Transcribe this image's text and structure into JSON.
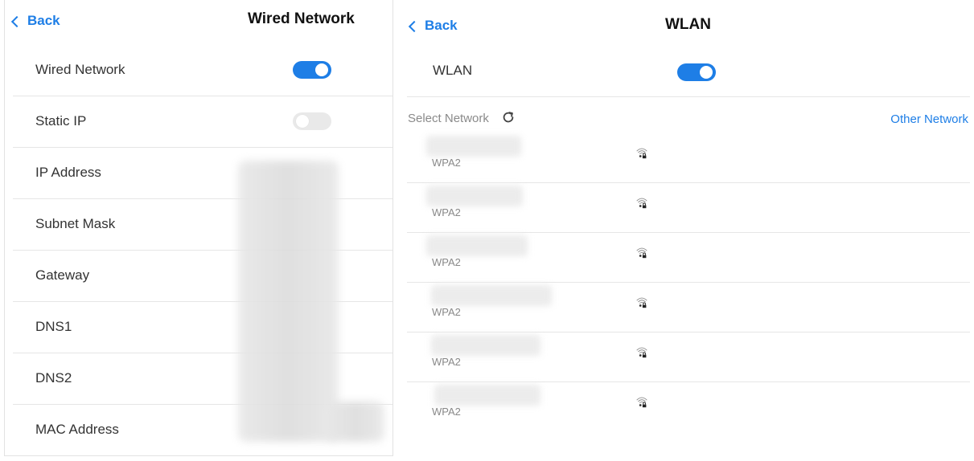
{
  "left": {
    "back_label": "Back",
    "title": "Wired Network",
    "rows": [
      {
        "label": "Wired Network",
        "toggle": "on"
      },
      {
        "label": "Static IP",
        "toggle": "off"
      },
      {
        "label": "IP Address"
      },
      {
        "label": "Subnet Mask"
      },
      {
        "label": "Gateway"
      },
      {
        "label": "DNS1"
      },
      {
        "label": "DNS2"
      },
      {
        "label": "MAC Address"
      }
    ]
  },
  "right": {
    "back_label": "Back",
    "title": "WLAN",
    "wlan_label": "WLAN",
    "wlan_toggle": "on",
    "select_label": "Select Network",
    "other_label": "Other Network",
    "networks": [
      {
        "security": "WPA2"
      },
      {
        "security": "WPA2"
      },
      {
        "security": "WPA2"
      },
      {
        "security": "WPA2"
      },
      {
        "security": "WPA2"
      },
      {
        "security": "WPA2"
      }
    ]
  },
  "colors": {
    "accent": "#1e7ee6",
    "toggle_off": "#e9e9e9",
    "divider": "#e6e6e6"
  }
}
